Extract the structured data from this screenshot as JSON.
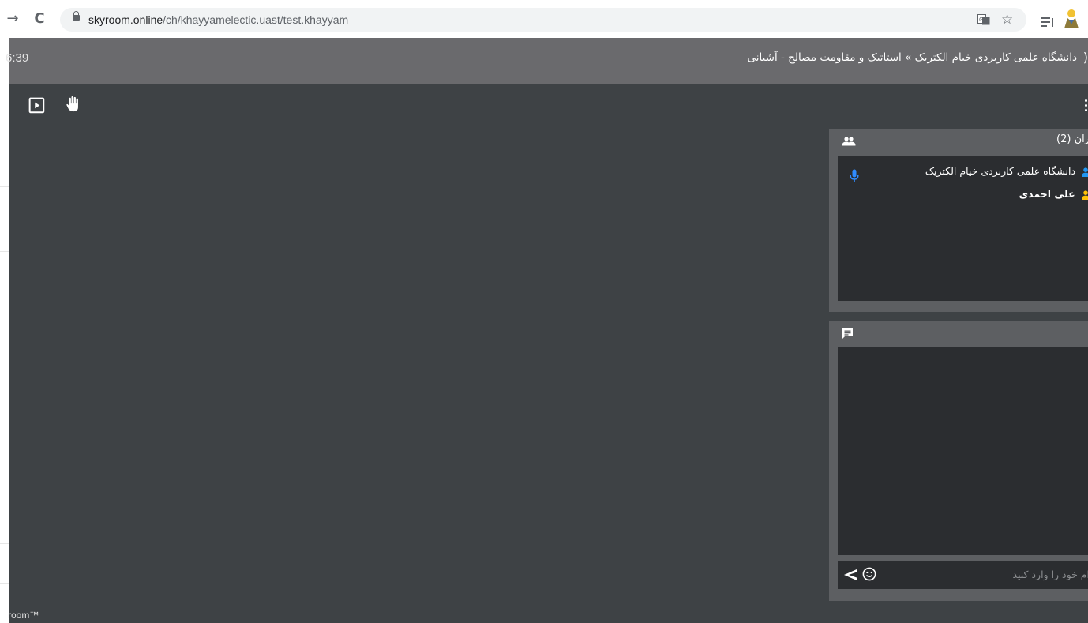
{
  "browser": {
    "url_host": "skyroom.online",
    "url_path": "/ch/khayyamelectic.uast/test.khayyam"
  },
  "app": {
    "clock": "6:39",
    "room_title": "دانشگاه علمی کاربردی خیام الکتریک » استاتیک و مقاومت مصالح - آشیانی",
    "footer": "room™"
  },
  "users_panel": {
    "title": "ران (2)",
    "users": [
      {
        "name": "دانشگاه علمی کاربردی خیام الکتریک",
        "role_color": "#2196f3",
        "mic": true
      },
      {
        "name": "علی احمدی",
        "role_color": "#ffc107",
        "mic": false
      }
    ]
  },
  "chat_panel": {
    "input_placeholder": "ام خود را وارد کنید"
  },
  "colors": {
    "header_bg": "#6a6a6d",
    "stage_bg": "#3e4245",
    "panel_bg": "#5d5f62",
    "panel_body_bg": "#2b2d30",
    "mic_color": "#2f8bff"
  }
}
